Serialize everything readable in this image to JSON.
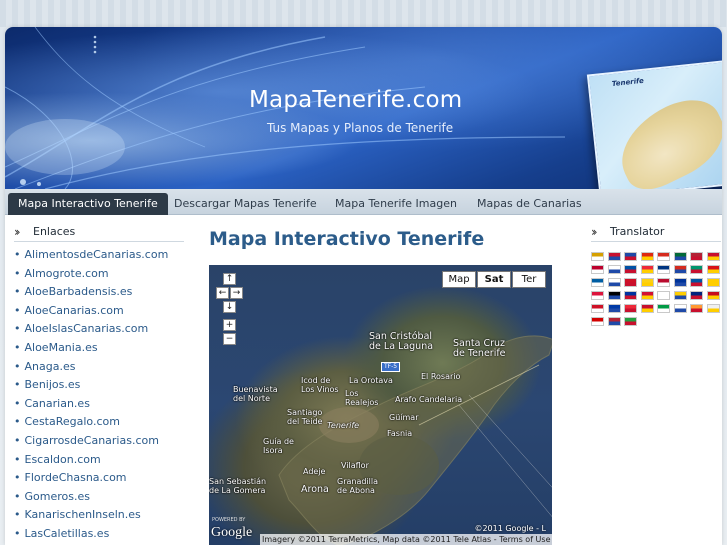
{
  "site": {
    "title": "MapaTenerife.com",
    "subtitle": "Tus Mapas y Planos de Tenerife",
    "banner_map_title": "Tenerife"
  },
  "nav": {
    "items": [
      {
        "label": "Mapa Interactivo Tenerife",
        "active": true
      },
      {
        "label": "Descargar Mapas Tenerife",
        "active": false
      },
      {
        "label": "Mapa Tenerife Imagen",
        "active": false
      },
      {
        "label": "Mapas de Canarias",
        "active": false
      }
    ]
  },
  "sidebar_left": {
    "heading": "Enlaces",
    "links": [
      "AlimentosdeCanarias.com",
      "Almogrote.com",
      "AloeBarbadensis.es",
      "AloeCanarias.com",
      "AloeIslasCanarias.com",
      "AloeMania.es",
      "Anaga.es",
      "Benijos.es",
      "Canarian.es",
      "CestaRegalo.com",
      "CigarrosdeCanarias.com",
      "Escaldon.com",
      "FlordeChasna.com",
      "Gomeros.es",
      "KanarischenInseln.es",
      "LasCaletillas.es"
    ]
  },
  "main": {
    "title": "Mapa Interactivo Tenerife",
    "map": {
      "type_buttons": [
        "Map",
        "Sat",
        "Ter"
      ],
      "selected_type": "Sat",
      "controls": {
        "up": "↑",
        "left": "←",
        "right": "→",
        "down": "↓",
        "zoom_in": "+",
        "zoom_out": "−"
      },
      "places": {
        "la_laguna": "San Cristóbal de La Laguna",
        "la_laguna_1": "San Cristóbal",
        "la_laguna_2": "de La Laguna",
        "santa_cruz_1": "Santa Cruz",
        "santa_cruz_2": "de Tenerife",
        "el_rosario": "El Rosario",
        "icod": "Icod de",
        "icod_2": "Los Vinos",
        "la_orotava": "La Orotava",
        "buenavista_1": "Buenavista",
        "buenavista_2": "del Norte",
        "los_realejos_1": "Los",
        "los_realejos_2": "Realejos",
        "arafo": "Arafo",
        "candelaria": "Candelaria",
        "santiago_1": "Santiago",
        "santiago_2": "del Teide",
        "tenerife": "Tenerife",
        "guimar": "Güímar",
        "fasnia": "Fasnia",
        "guia_1": "Guía de",
        "guia_2": "Isora",
        "adeje": "Adeje",
        "vilaflor": "Vilaflor",
        "san_sebastian_1": "San Sebastián",
        "san_sebastian_2": "de La Gomera",
        "arona": "Arona",
        "granadilla_1": "Granadilla",
        "granadilla_2": "de Abona",
        "road": "TF-5"
      },
      "powered_by": "POWERED BY",
      "logo": "Google",
      "copyright": "©2011 Google - L",
      "attribution": "Imagery ©2011 TerraMetrics, Map data ©2011 Tele Atlas - Terms of Use"
    }
  },
  "sidebar_right": {
    "heading": "Translator",
    "flags": [
      "#d6a000",
      "#c8102e",
      "#1f4aa8",
      "#de2910",
      "#d52b1e",
      "#046a38",
      "#b22234",
      "#c8102e",
      "#bc002d",
      "#ffffff",
      "#0052a5",
      "#ed2939",
      "#003580",
      "#d52b1e",
      "#00966e",
      "#d7141a",
      "#005ea3",
      "#ffffff",
      "#ce1126",
      "#fcd116",
      "#ba0c2f",
      "#003399",
      "#0055a4",
      "#ffce00",
      "#dc143c",
      "#000000",
      "#0033a0",
      "#d21034",
      "#ffffff",
      "#ffcd00",
      "#00247d",
      "#c60b1e",
      "#ce1126",
      "#0039a6",
      "#ed2939",
      "#c8102e",
      "#009a44",
      "#ffffff",
      "#ff9933",
      "#f0f0f0",
      "#d20000",
      "#b22234",
      "#239f40"
    ]
  }
}
